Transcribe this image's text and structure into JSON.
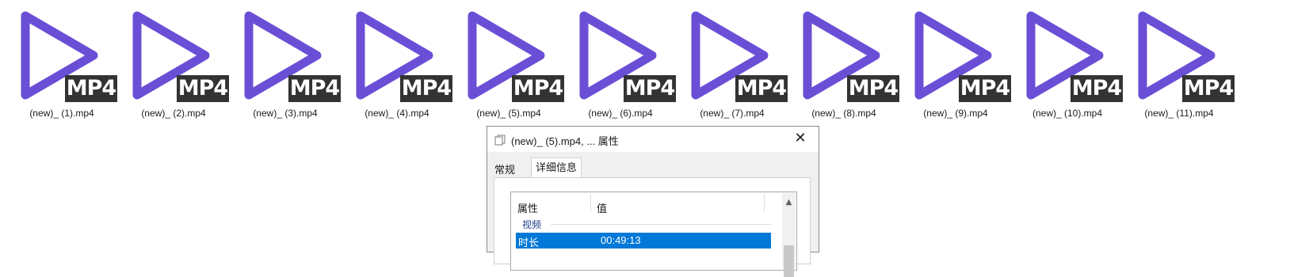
{
  "files": [
    {
      "name": "(new)_ (1).mp4",
      "badge": "MP4"
    },
    {
      "name": "(new)_ (2).mp4",
      "badge": "MP4"
    },
    {
      "name": "(new)_ (3).mp4",
      "badge": "MP4"
    },
    {
      "name": "(new)_ (4).mp4",
      "badge": "MP4"
    },
    {
      "name": "(new)_ (5).mp4",
      "badge": "MP4"
    },
    {
      "name": "(new)_ (6).mp4",
      "badge": "MP4"
    },
    {
      "name": "(new)_ (7).mp4",
      "badge": "MP4"
    },
    {
      "name": "(new)_ (8).mp4",
      "badge": "MP4"
    },
    {
      "name": "(new)_ (9).mp4",
      "badge": "MP4"
    },
    {
      "name": "(new)_ (10).mp4",
      "badge": "MP4"
    },
    {
      "name": "(new)_ (11).mp4",
      "badge": "MP4"
    }
  ],
  "colors": {
    "play_icon": "#6a4fd6",
    "badge_bg": "#333333",
    "selection": "#0078d7"
  },
  "dialog": {
    "title": "(new)_ (5).mp4, ... 属性",
    "close_icon": "close-icon",
    "tabs": {
      "general": "常规",
      "details": "详细信息"
    },
    "columns": {
      "property": "属性",
      "value": "值"
    },
    "section": "视频",
    "selected_row": {
      "property": "时长",
      "value": "00:49:13"
    }
  }
}
